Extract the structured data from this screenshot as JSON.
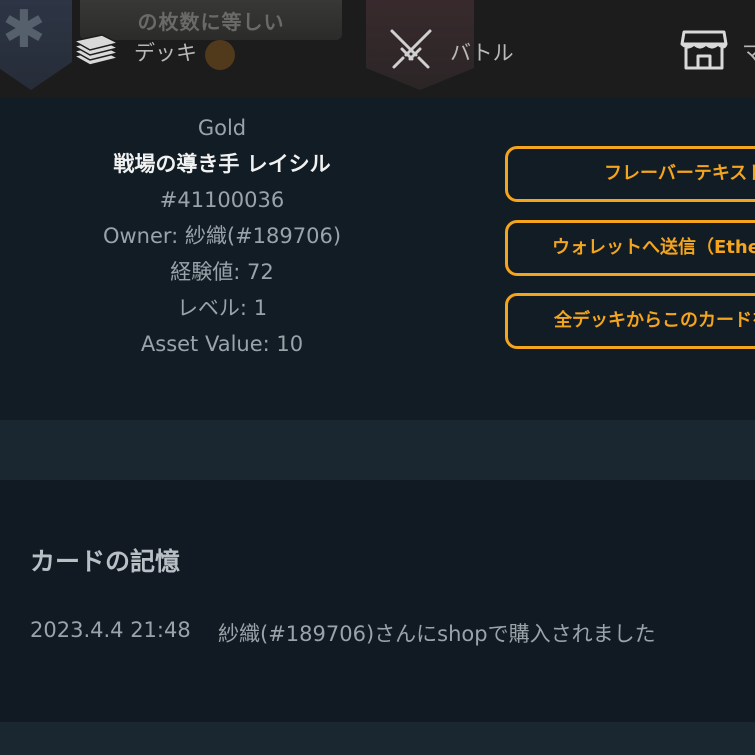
{
  "nav": {
    "banner_text": "の枚数に等しい",
    "items": [
      {
        "label": "デッキ",
        "icon": "deck-icon"
      },
      {
        "label": "バトル",
        "icon": "swords-icon"
      },
      {
        "label": "マ",
        "icon": "shop-icon"
      }
    ]
  },
  "card": {
    "rarity": "Gold",
    "name": "戦場の導き手 レイシル",
    "id": "#41100036",
    "owner": "Owner: 紗織(#189706)",
    "exp": "経験値: 72",
    "level": "レベル: 1",
    "asset_value": "Asset Value: 10"
  },
  "actions": {
    "flavor_text": "フレーバーテキスト",
    "send_wallet": "ウォレットへ送信（Ethereum）",
    "remove_all_decks": "全デッキからこのカードを外す"
  },
  "memory": {
    "title": "カードの記憶",
    "entries": [
      {
        "date": "2023.4.4 21:48",
        "text": "紗織(#189706)さんにshopで購入されました"
      }
    ]
  },
  "colors": {
    "accent": "#f4a41d",
    "background": "#0f1a22"
  }
}
